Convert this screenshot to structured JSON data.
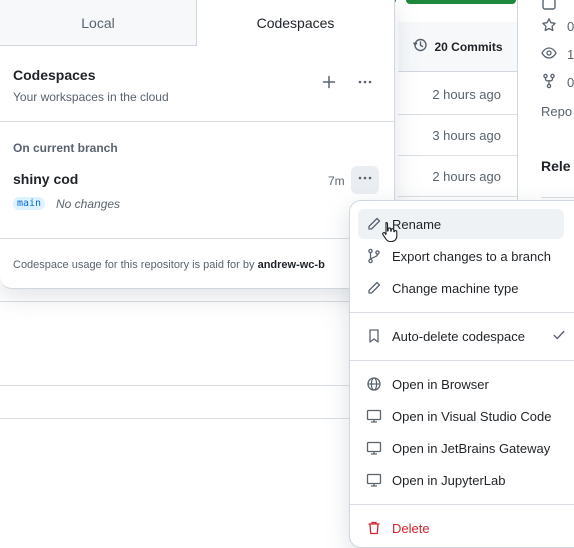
{
  "tabs": [
    {
      "label": "Local",
      "active": false
    },
    {
      "label": "Codespaces",
      "active": true
    }
  ],
  "codespaces": {
    "title": "Codespaces",
    "subtitle": "Your workspaces in the cloud",
    "add_icon": "plus-icon",
    "more_icon": "kebab-horizontal-icon"
  },
  "branch_section": {
    "label": "On current branch",
    "item": {
      "name": "shiny cod",
      "age": "7m",
      "branch": "main",
      "status": "No changes"
    }
  },
  "usage": {
    "prefix": "Codespace usage for this repository is paid for by ",
    "owner": "andrew-wc-b"
  },
  "repo": {
    "commits_label": "20 Commits",
    "times": [
      "2 hours ago",
      "3 hours ago",
      "2 hours ago"
    ],
    "side_counts": [
      "0",
      "1",
      "0"
    ],
    "side_repo": "Repo",
    "side_release": "Rele"
  },
  "menu": {
    "items": [
      {
        "label": "Rename",
        "icon": "pencil-icon"
      },
      {
        "label": "Export changes to a branch",
        "icon": "git-branch-icon"
      },
      {
        "label": "Change machine type",
        "icon": "pencil-icon"
      },
      {
        "label": "Auto-delete codespace",
        "icon": "bookmark-icon",
        "checked": true
      },
      {
        "label": "Open in Browser",
        "icon": "globe-icon"
      },
      {
        "label": "Open in Visual Studio Code",
        "icon": "desktop-icon"
      },
      {
        "label": "Open in JetBrains Gateway",
        "icon": "desktop-icon"
      },
      {
        "label": "Open in JupyterLab",
        "icon": "desktop-icon"
      },
      {
        "label": "Delete",
        "icon": "trash-icon"
      }
    ]
  },
  "colors": {
    "accent": "#0969da",
    "danger": "#d1242f",
    "primary_button": "#1f883d"
  }
}
